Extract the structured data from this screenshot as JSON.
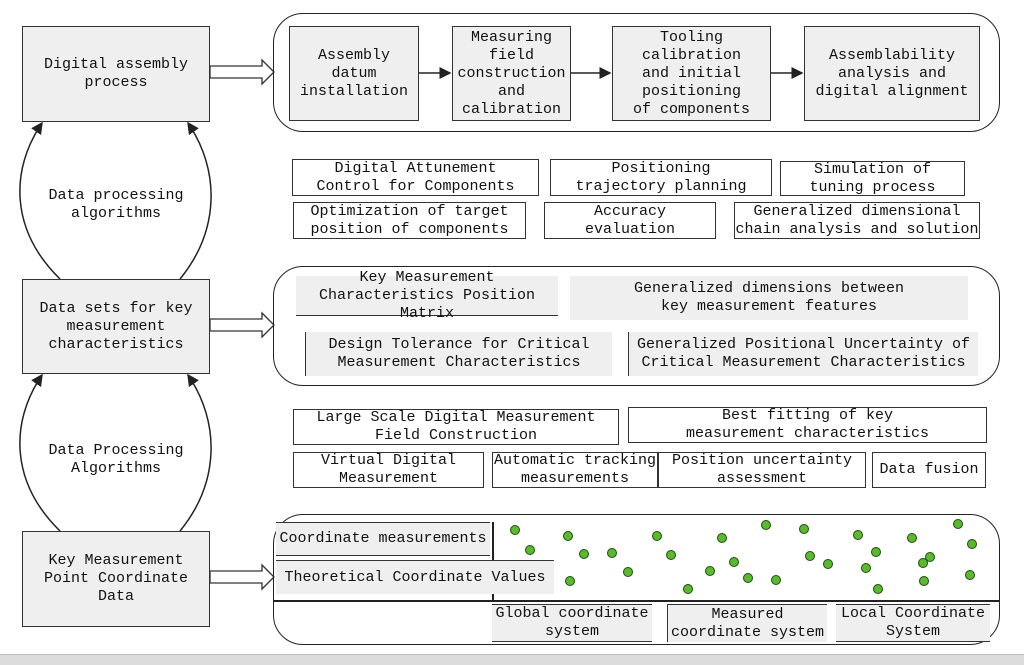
{
  "left_column": {
    "boxes": [
      "Digital assembly\nprocess",
      "Data sets for key\nmeasurement\ncharacteristics",
      "Key Measurement\nPoint Coordinate\nData"
    ],
    "loop_labels": [
      "Data processing\nalgorithms",
      "Data Processing\nAlgorithms"
    ]
  },
  "assembly_process": {
    "steps": [
      "Assembly\ndatum\ninstallation",
      "Measuring\nfield\nconstruction\nand\ncalibration",
      "Tooling\ncalibration\nand initial\npositioning\nof components",
      "Assemblability\nanalysis and\ndigital alignment"
    ]
  },
  "algorithms_1": [
    "Digital Attunement\nControl for Components",
    "Positioning\ntrajectory planning",
    "Simulation of\ntuning process",
    "Optimization of target\nposition of components",
    "Accuracy\nevaluation",
    "Generalized dimensional\nchain analysis and solution"
  ],
  "datasets": [
    "Key Measurement\nCharacteristics Position Matrix",
    "Generalized dimensions between\nkey measurement features",
    "Design Tolerance for Critical\nMeasurement Characteristics",
    "Generalized Positional Uncertainty of\nCritical Measurement Characteristics"
  ],
  "algorithms_2": [
    "Large Scale Digital Measurement\nField Construction",
    "Best fitting of key\nmeasurement characteristics",
    "Virtual Digital\nMeasurement",
    "Automatic tracking\nmeasurements",
    "Position uncertainty\nassessment",
    "Data fusion"
  ],
  "coordinates": {
    "rows": [
      "Coordinate measurements",
      "Theoretical Coordinate Values"
    ],
    "systems": [
      "Global coordinate\nsystem",
      "Measured\ncoordinate system",
      "Local Coordinate\nSystem"
    ],
    "point_color": "#5cb82e"
  }
}
